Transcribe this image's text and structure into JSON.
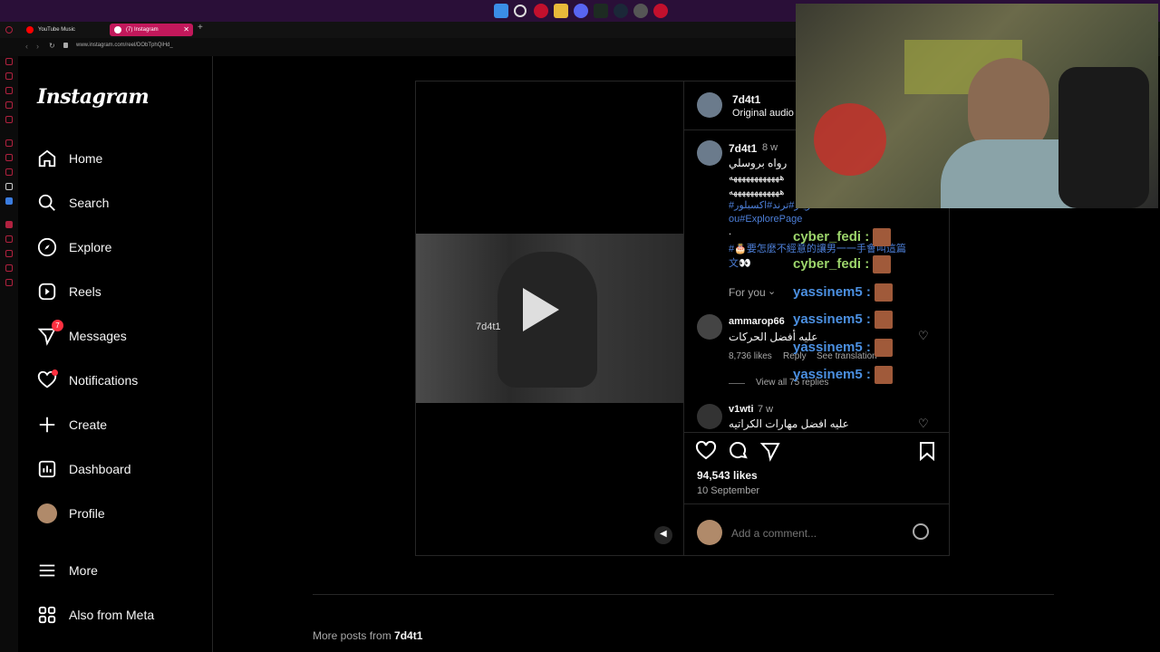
{
  "browser": {
    "tabs": [
      {
        "label": "YouTube Music"
      },
      {
        "label": "(7) Instagram"
      }
    ],
    "url": "www.instagram.com/reel/DObTphQiHd_"
  },
  "sidebar": {
    "logo": "Instagram",
    "items": [
      {
        "label": "Home",
        "icon": "home-icon"
      },
      {
        "label": "Search",
        "icon": "search-icon"
      },
      {
        "label": "Explore",
        "icon": "compass-icon"
      },
      {
        "label": "Reels",
        "icon": "reels-icon"
      },
      {
        "label": "Messages",
        "icon": "messenger-icon",
        "badge": "7"
      },
      {
        "label": "Notifications",
        "icon": "heart-icon"
      },
      {
        "label": "Create",
        "icon": "plus-icon"
      },
      {
        "label": "Dashboard",
        "icon": "dashboard-icon"
      },
      {
        "label": "Profile",
        "icon": "avatar-icon"
      },
      {
        "label": "More",
        "icon": "menu-icon"
      },
      {
        "label": "Also from Meta",
        "icon": "meta-icon"
      }
    ]
  },
  "video": {
    "watermark": "7d4t1"
  },
  "post": {
    "author": "7d4t1",
    "audio": "Original audio",
    "caption": {
      "author": "7d4t1",
      "age": "8 w",
      "line1": "رواه بروسلي",
      "line2": "ههههههههههههه",
      "line3": "ههههههههههههه",
      "line4": "#ريلز#ترند#اكسبلور",
      "line5": "ou#ExplorePage",
      "line6": ".",
      "line7": "#🎂要怎麼不經意的讓男一一手會叫這篇",
      "line8": "文👀"
    },
    "sort": "For you",
    "comments": [
      {
        "user": "ammarop66",
        "text": "عليه أفضل الحركات",
        "likes": "8,736 likes",
        "reply": "Reply",
        "translate": "See translation",
        "view_replies": "View all 75 replies"
      },
      {
        "user": "v1wti",
        "age": "7 w",
        "text": "عليه افضل مهارات الكراتيه"
      }
    ],
    "likes": "94,543 likes",
    "date": "10 September",
    "comment_placeholder": "Add a comment..."
  },
  "chat": [
    {
      "user": "cyber_fedi :"
    },
    {
      "user": "cyber_fedi :"
    },
    {
      "user": "yassinem5 :"
    },
    {
      "user": "yassinem5 :"
    },
    {
      "user": "yassinem5 :"
    },
    {
      "user": "yassinem5 :"
    }
  ],
  "more_posts": {
    "prefix": "More posts from",
    "author": "7d4t1"
  },
  "colors": {
    "accent_red": "#ff3040",
    "link_blue": "#4d7fd8",
    "chat_green": "#9cd46b",
    "chat_blue": "#4b8fe0"
  }
}
